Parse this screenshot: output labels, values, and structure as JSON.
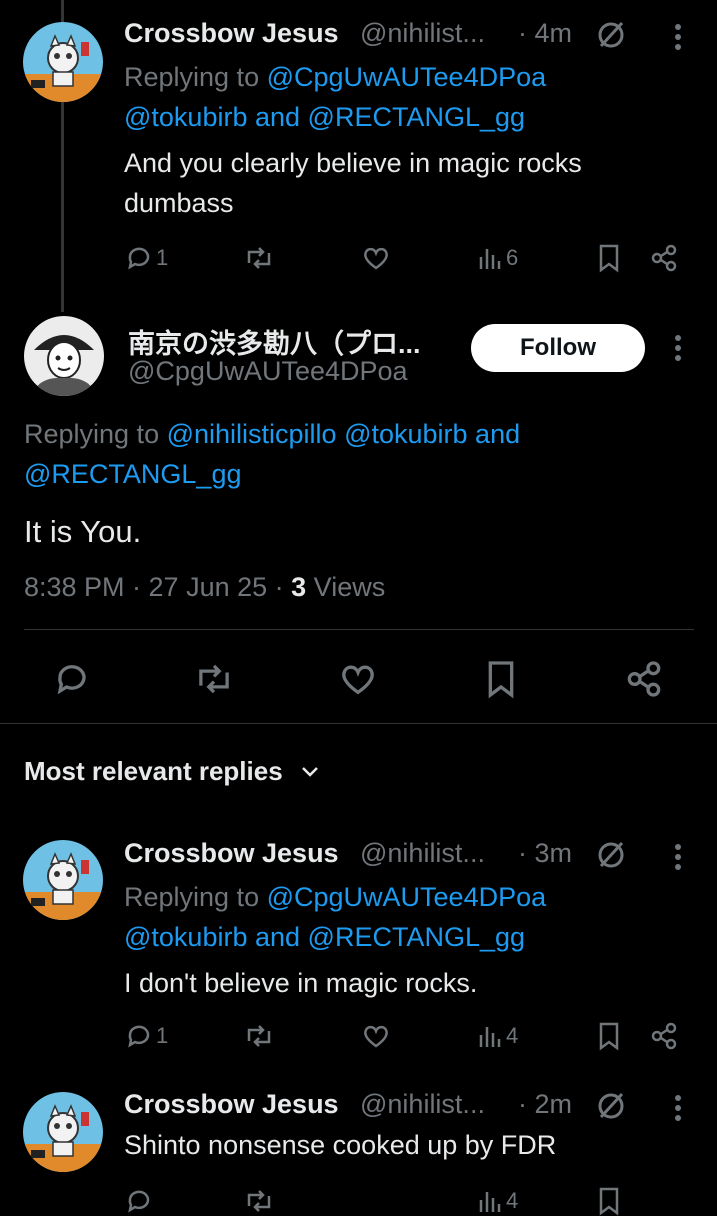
{
  "thread_reply": {
    "author_name": "Crossbow Jesus",
    "handle": "@nihilist...",
    "time": "· 4m",
    "replying_label": "Replying to ",
    "replying_user1": "@CpgUwAUTee4DPoa",
    "replying_user2": "@tokubirb",
    "replying_and": " and ",
    "replying_user3": "@RECTANGL_gg",
    "text_line1": "And you clearly believe in magic rocks",
    "text_line2": "dumbass",
    "replies": "1",
    "views": "6"
  },
  "main_post": {
    "author_name": "南京の渋多勘八（プロ...",
    "handle": "@CpgUwAUTee4DPoa",
    "follow_label": "Follow",
    "replying_label": "Replying to ",
    "replying_user1": "@nihilisticpillo",
    "replying_user2": "@tokubirb",
    "replying_and": " and ",
    "replying_user3": "@RECTANGL_gg",
    "text": "It is You.",
    "timestamp": "8:38 PM · 27 Jun 25 · ",
    "views_count": "3",
    "views_label": " Views"
  },
  "replies_header": {
    "label": "Most relevant replies"
  },
  "reply1": {
    "author_name": "Crossbow Jesus",
    "handle": "@nihilist...",
    "time": "· 3m",
    "replying_label": "Replying to ",
    "replying_user1": "@CpgUwAUTee4DPoa",
    "replying_user2": "@tokubirb",
    "replying_and": " and ",
    "replying_user3": "@RECTANGL_gg",
    "text": "I don't believe in magic rocks.",
    "replies": "1",
    "views": "4"
  },
  "reply2": {
    "author_name": "Crossbow Jesus",
    "handle": "@nihilist...",
    "time": "· 2m",
    "text": "Shinto nonsense cooked up by FDR",
    "views": "4"
  },
  "colors": {
    "background": "#000000",
    "link": "#1d9bf0",
    "muted": "#71767b",
    "text": "#e7e9ea"
  }
}
